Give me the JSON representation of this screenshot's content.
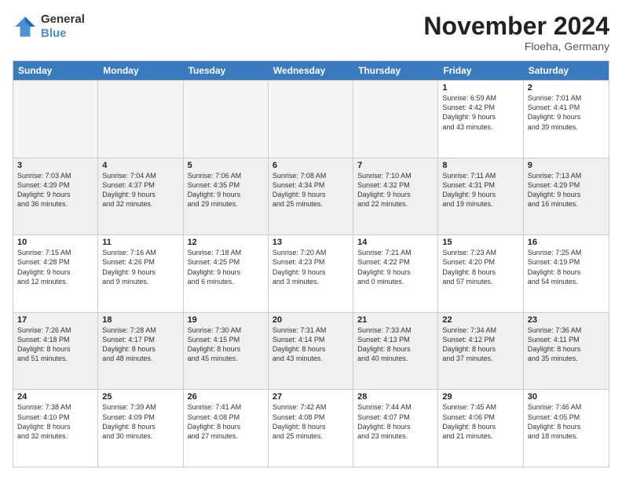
{
  "header": {
    "logo_line1": "General",
    "logo_line2": "Blue",
    "month_year": "November 2024",
    "location": "Floeha, Germany"
  },
  "weekdays": [
    "Sunday",
    "Monday",
    "Tuesday",
    "Wednesday",
    "Thursday",
    "Friday",
    "Saturday"
  ],
  "rows": [
    [
      {
        "day": "",
        "info": "",
        "empty": true
      },
      {
        "day": "",
        "info": "",
        "empty": true
      },
      {
        "day": "",
        "info": "",
        "empty": true
      },
      {
        "day": "",
        "info": "",
        "empty": true
      },
      {
        "day": "",
        "info": "",
        "empty": true
      },
      {
        "day": "1",
        "info": "Sunrise: 6:59 AM\nSunset: 4:42 PM\nDaylight: 9 hours\nand 43 minutes.",
        "empty": false
      },
      {
        "day": "2",
        "info": "Sunrise: 7:01 AM\nSunset: 4:41 PM\nDaylight: 9 hours\nand 39 minutes.",
        "empty": false
      }
    ],
    [
      {
        "day": "3",
        "info": "Sunrise: 7:03 AM\nSunset: 4:39 PM\nDaylight: 9 hours\nand 36 minutes.",
        "empty": false
      },
      {
        "day": "4",
        "info": "Sunrise: 7:04 AM\nSunset: 4:37 PM\nDaylight: 9 hours\nand 32 minutes.",
        "empty": false
      },
      {
        "day": "5",
        "info": "Sunrise: 7:06 AM\nSunset: 4:35 PM\nDaylight: 9 hours\nand 29 minutes.",
        "empty": false
      },
      {
        "day": "6",
        "info": "Sunrise: 7:08 AM\nSunset: 4:34 PM\nDaylight: 9 hours\nand 25 minutes.",
        "empty": false
      },
      {
        "day": "7",
        "info": "Sunrise: 7:10 AM\nSunset: 4:32 PM\nDaylight: 9 hours\nand 22 minutes.",
        "empty": false
      },
      {
        "day": "8",
        "info": "Sunrise: 7:11 AM\nSunset: 4:31 PM\nDaylight: 9 hours\nand 19 minutes.",
        "empty": false
      },
      {
        "day": "9",
        "info": "Sunrise: 7:13 AM\nSunset: 4:29 PM\nDaylight: 9 hours\nand 16 minutes.",
        "empty": false
      }
    ],
    [
      {
        "day": "10",
        "info": "Sunrise: 7:15 AM\nSunset: 4:28 PM\nDaylight: 9 hours\nand 12 minutes.",
        "empty": false
      },
      {
        "day": "11",
        "info": "Sunrise: 7:16 AM\nSunset: 4:26 PM\nDaylight: 9 hours\nand 9 minutes.",
        "empty": false
      },
      {
        "day": "12",
        "info": "Sunrise: 7:18 AM\nSunset: 4:25 PM\nDaylight: 9 hours\nand 6 minutes.",
        "empty": false
      },
      {
        "day": "13",
        "info": "Sunrise: 7:20 AM\nSunset: 4:23 PM\nDaylight: 9 hours\nand 3 minutes.",
        "empty": false
      },
      {
        "day": "14",
        "info": "Sunrise: 7:21 AM\nSunset: 4:22 PM\nDaylight: 9 hours\nand 0 minutes.",
        "empty": false
      },
      {
        "day": "15",
        "info": "Sunrise: 7:23 AM\nSunset: 4:20 PM\nDaylight: 8 hours\nand 57 minutes.",
        "empty": false
      },
      {
        "day": "16",
        "info": "Sunrise: 7:25 AM\nSunset: 4:19 PM\nDaylight: 8 hours\nand 54 minutes.",
        "empty": false
      }
    ],
    [
      {
        "day": "17",
        "info": "Sunrise: 7:26 AM\nSunset: 4:18 PM\nDaylight: 8 hours\nand 51 minutes.",
        "empty": false
      },
      {
        "day": "18",
        "info": "Sunrise: 7:28 AM\nSunset: 4:17 PM\nDaylight: 8 hours\nand 48 minutes.",
        "empty": false
      },
      {
        "day": "19",
        "info": "Sunrise: 7:30 AM\nSunset: 4:15 PM\nDaylight: 8 hours\nand 45 minutes.",
        "empty": false
      },
      {
        "day": "20",
        "info": "Sunrise: 7:31 AM\nSunset: 4:14 PM\nDaylight: 8 hours\nand 43 minutes.",
        "empty": false
      },
      {
        "day": "21",
        "info": "Sunrise: 7:33 AM\nSunset: 4:13 PM\nDaylight: 8 hours\nand 40 minutes.",
        "empty": false
      },
      {
        "day": "22",
        "info": "Sunrise: 7:34 AM\nSunset: 4:12 PM\nDaylight: 8 hours\nand 37 minutes.",
        "empty": false
      },
      {
        "day": "23",
        "info": "Sunrise: 7:36 AM\nSunset: 4:11 PM\nDaylight: 8 hours\nand 35 minutes.",
        "empty": false
      }
    ],
    [
      {
        "day": "24",
        "info": "Sunrise: 7:38 AM\nSunset: 4:10 PM\nDaylight: 8 hours\nand 32 minutes.",
        "empty": false
      },
      {
        "day": "25",
        "info": "Sunrise: 7:39 AM\nSunset: 4:09 PM\nDaylight: 8 hours\nand 30 minutes.",
        "empty": false
      },
      {
        "day": "26",
        "info": "Sunrise: 7:41 AM\nSunset: 4:08 PM\nDaylight: 8 hours\nand 27 minutes.",
        "empty": false
      },
      {
        "day": "27",
        "info": "Sunrise: 7:42 AM\nSunset: 4:08 PM\nDaylight: 8 hours\nand 25 minutes.",
        "empty": false
      },
      {
        "day": "28",
        "info": "Sunrise: 7:44 AM\nSunset: 4:07 PM\nDaylight: 8 hours\nand 23 minutes.",
        "empty": false
      },
      {
        "day": "29",
        "info": "Sunrise: 7:45 AM\nSunset: 4:06 PM\nDaylight: 8 hours\nand 21 minutes.",
        "empty": false
      },
      {
        "day": "30",
        "info": "Sunrise: 7:46 AM\nSunset: 4:05 PM\nDaylight: 8 hours\nand 18 minutes.",
        "empty": false
      }
    ]
  ]
}
